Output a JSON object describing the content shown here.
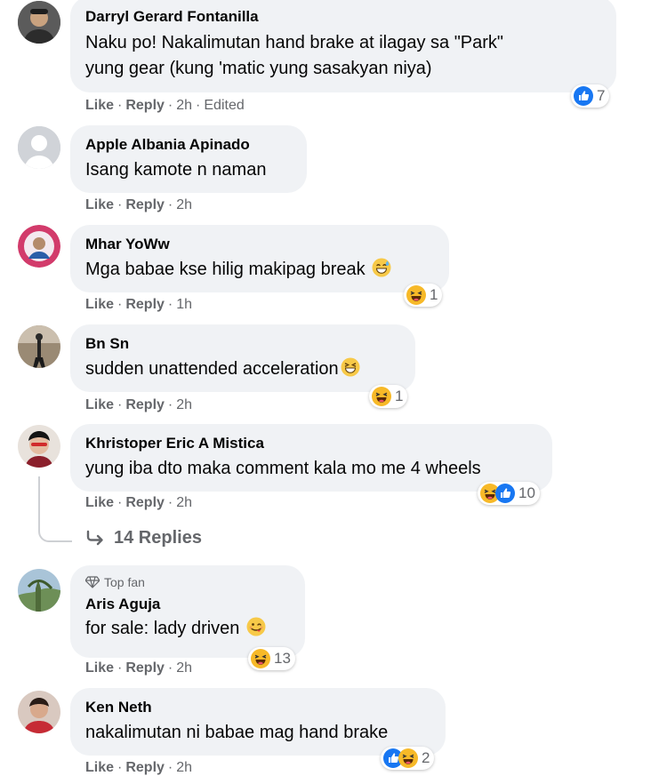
{
  "comments": [
    {
      "author": "Darryl Gerard Fontanilla",
      "lines": [
        "Naku po! Nakalimutan hand brake at ilagay sa \"Park\"",
        "yung gear (kung 'matic yung sasakyan niya)"
      ],
      "like": "Like",
      "reply": "Reply",
      "time": "2h",
      "edited": "Edited",
      "reaction_count": "7",
      "reactions": [
        "like"
      ]
    },
    {
      "author": "Apple Albania Apinado",
      "text": "Isang kamote n naman",
      "like": "Like",
      "reply": "Reply",
      "time": "2h"
    },
    {
      "author": "Mhar YoWw",
      "text": "Mga babae kse hilig makipag break",
      "inline_emoji": "grin-sweat",
      "like": "Like",
      "reply": "Reply",
      "time": "1h",
      "reaction_count": "1",
      "reactions": [
        "haha"
      ]
    },
    {
      "author": "Bn Sn",
      "text": "sudden unattended acceleration",
      "inline_emoji": "grin-squint",
      "like": "Like",
      "reply": "Reply",
      "time": "2h",
      "reaction_count": "1",
      "reactions": [
        "haha"
      ]
    },
    {
      "author": "Khristoper Eric A Mistica",
      "text": "yung iba dto maka comment kala mo me 4 wheels",
      "like": "Like",
      "reply": "Reply",
      "time": "2h",
      "reaction_count": "10",
      "reactions": [
        "haha",
        "like"
      ]
    },
    {
      "badge": "Top fan",
      "author": "Aris Aguja",
      "text": "for sale: lady driven",
      "inline_emoji": "wink-tongue",
      "like": "Like",
      "reply": "Reply",
      "time": "2h",
      "reaction_count": "13",
      "reactions": [
        "haha"
      ]
    },
    {
      "author": "Ken Neth",
      "text": "nakalimutan ni babae mag hand brake",
      "like": "Like",
      "reply": "Reply",
      "time": "2h",
      "reaction_count": "2",
      "reactions": [
        "like",
        "haha"
      ]
    }
  ],
  "replies_link": "14 Replies",
  "colors": {
    "bubble": "#f0f2f5",
    "meta": "#65676b",
    "like_blue": "#1877f2",
    "haha_yellow": "#f7b928"
  }
}
